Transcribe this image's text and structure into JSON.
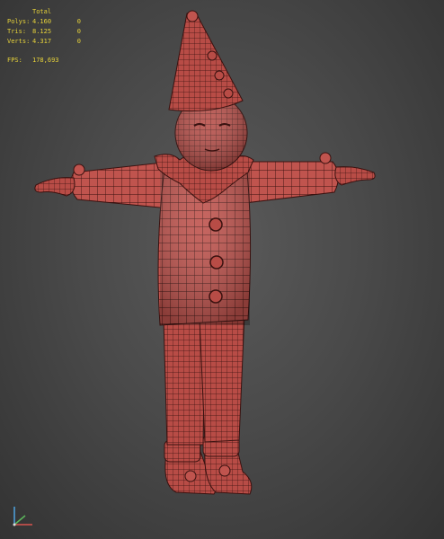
{
  "viewport": {
    "stats": {
      "header": "Total",
      "rows": [
        {
          "label": "Polys:",
          "total": "4.160",
          "selected": "0"
        },
        {
          "label": "Tris:",
          "total": "8.125",
          "selected": "0"
        },
        {
          "label": "Verts:",
          "total": "4.317",
          "selected": "0"
        }
      ],
      "fps_label": "FPS:",
      "fps_value": "178,693"
    },
    "colors": {
      "background": "#4a4a4a",
      "stats_text": "#e6d23a",
      "model_fill": "#c0544e",
      "wire": "#3a1210"
    },
    "gizmo_icon": "axis-gizmo-icon",
    "model_icon": "clown-character-wireframe"
  }
}
